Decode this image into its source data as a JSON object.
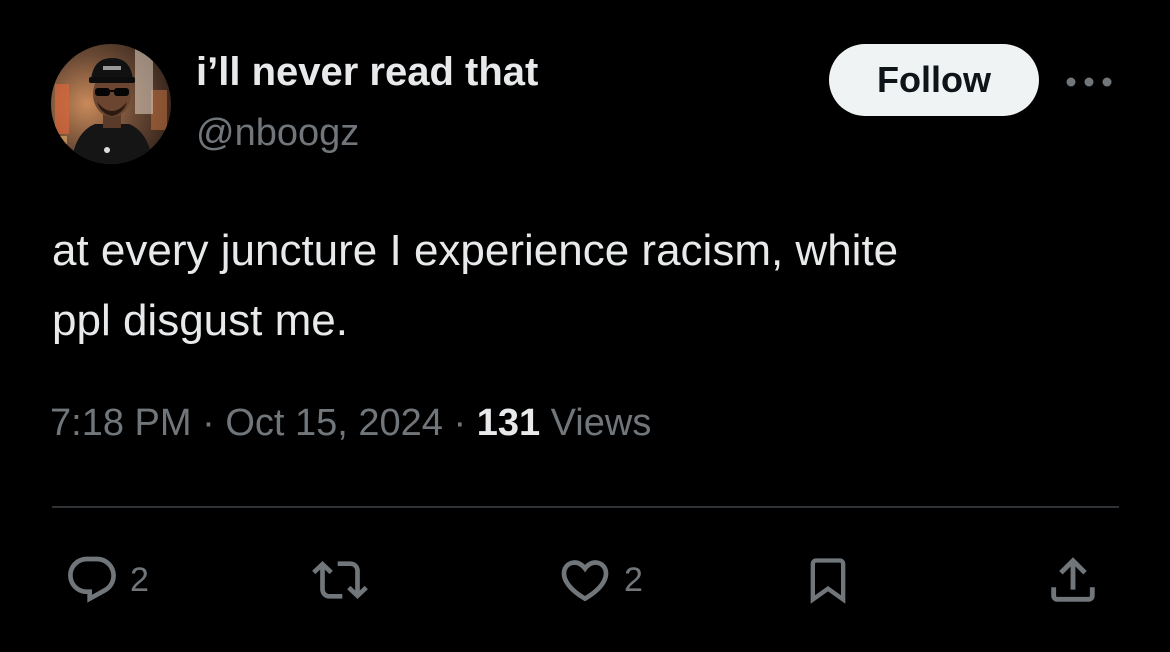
{
  "author": {
    "display_name": "i’ll never read that",
    "handle": "@nboogz",
    "avatar": "profile-photo-avatar"
  },
  "header": {
    "follow_label": "Follow",
    "more_icon": "more-horizontal-icon"
  },
  "tweet": {
    "text_line1": "at every juncture I experience racism, white",
    "text_line2": "ppl disgust me."
  },
  "meta": {
    "time": "7:18 PM",
    "separator1": " · ",
    "date": "Oct 15, 2024",
    "separator2": " · ",
    "views_count": "131",
    "views_label": " Views"
  },
  "actions": {
    "reply": {
      "icon": "reply-icon",
      "count": "2"
    },
    "retweet": {
      "icon": "retweet-icon"
    },
    "like": {
      "icon": "heart-icon",
      "count": "2"
    },
    "bookmark": {
      "icon": "bookmark-icon"
    },
    "share": {
      "icon": "share-icon"
    }
  },
  "colors": {
    "background": "#000000",
    "primary_text": "#e7e9ea",
    "secondary_text": "#71767b",
    "follow_button_bg": "#eff3f4",
    "divider": "#2f3336"
  }
}
